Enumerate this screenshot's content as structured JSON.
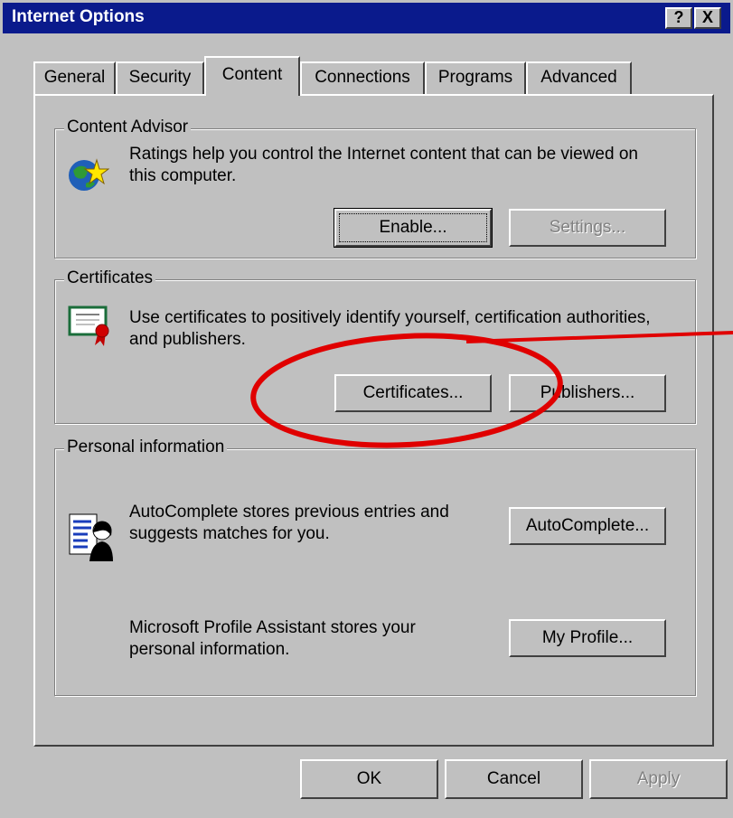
{
  "window": {
    "title": "Internet Options",
    "help_button": "?",
    "close_button": "X"
  },
  "tabs": [
    {
      "label": "General",
      "active": false
    },
    {
      "label": "Security",
      "active": false
    },
    {
      "label": "Content",
      "active": true
    },
    {
      "label": "Connections",
      "active": false
    },
    {
      "label": "Programs",
      "active": false
    },
    {
      "label": "Advanced",
      "active": false
    }
  ],
  "content_advisor": {
    "legend": "Content Advisor",
    "description": "Ratings help you control the Internet content that can be viewed on this computer.",
    "enable_button": "Enable...",
    "settings_button": "Settings..."
  },
  "certificates": {
    "legend": "Certificates",
    "description": "Use certificates to positively identify yourself, certification authorities, and publishers.",
    "certificates_button": "Certificates...",
    "publishers_button": "Publishers..."
  },
  "personal_information": {
    "legend": "Personal information",
    "autocomplete_description": "AutoComplete stores previous entries and suggests matches for you.",
    "autocomplete_button": "AutoComplete...",
    "profile_description": "Microsoft Profile Assistant stores your personal information.",
    "profile_button": "My Profile..."
  },
  "dialog_buttons": {
    "ok": "OK",
    "cancel": "Cancel",
    "apply": "Apply"
  },
  "annotation": {
    "color": "#e00000"
  }
}
